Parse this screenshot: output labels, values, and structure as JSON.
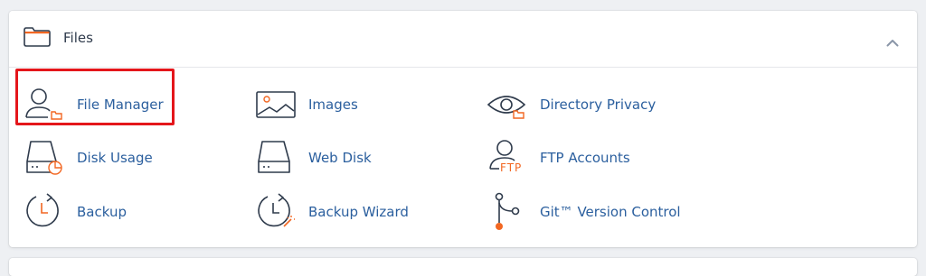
{
  "section": {
    "title": "Files",
    "collapse_icon": "chevron-up-icon"
  },
  "items": [
    {
      "label": "File Manager",
      "icon": "file-manager-icon"
    },
    {
      "label": "Images",
      "icon": "images-icon"
    },
    {
      "label": "Directory Privacy",
      "icon": "directory-privacy-icon"
    },
    {
      "label": "Disk Usage",
      "icon": "disk-usage-icon"
    },
    {
      "label": "Web Disk",
      "icon": "web-disk-icon"
    },
    {
      "label": "FTP Accounts",
      "icon": "ftp-accounts-icon"
    },
    {
      "label": "Backup",
      "icon": "backup-icon"
    },
    {
      "label": "Backup Wizard",
      "icon": "backup-wizard-icon"
    },
    {
      "label": "Git™ Version Control",
      "icon": "git-version-control-icon"
    }
  ],
  "colors": {
    "link": "#2b5f9e",
    "icon_stroke": "#2f3b4c",
    "accent": "#f26722",
    "highlight": "#e4161b"
  },
  "ftp_icon_text": "FTP"
}
